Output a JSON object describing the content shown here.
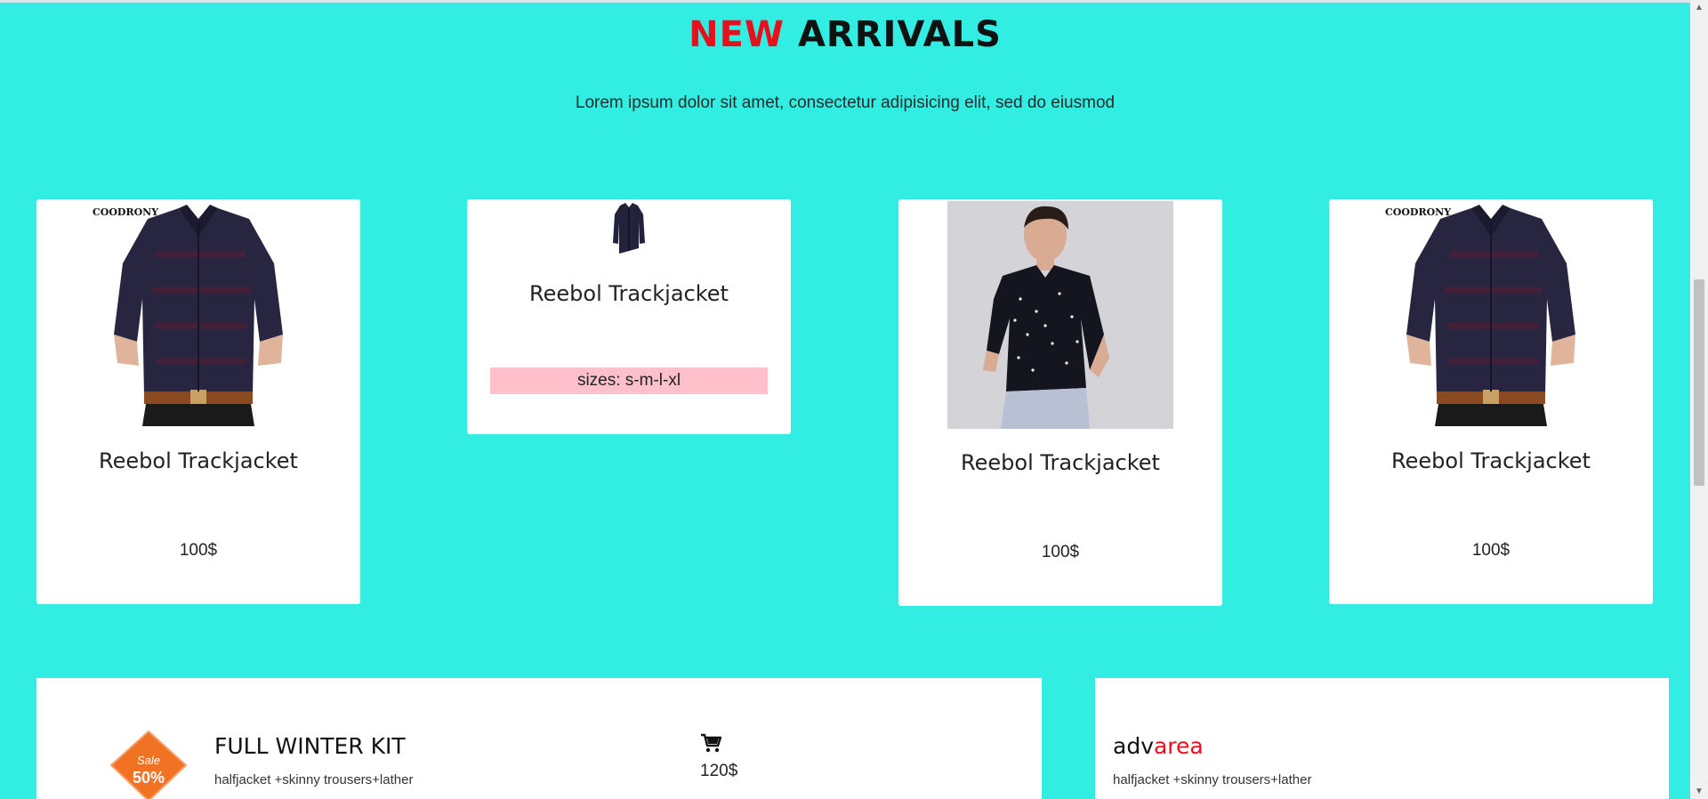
{
  "section": {
    "heading_highlight": "NEW",
    "heading_rest": "ARRIVALS",
    "subtitle": "Lorem ipsum dolor sit amet, consectetur adipisicing elit, sed do eiusmod"
  },
  "products": [
    {
      "title": "Reebol Trackjacket",
      "price": "100$",
      "image": "shirt-photo",
      "brand": "COODRONY"
    },
    {
      "title": "Reebol Trackjacket",
      "sizes": "sizes: s-m-l-xl",
      "image": "jacket-thumbnail"
    },
    {
      "title": "Reebol Trackjacket",
      "price": "100$",
      "image": "model-photo"
    },
    {
      "title": "Reebol Trackjacket",
      "price": "100$",
      "image": "shirt-photo",
      "brand": "COODRONY"
    }
  ],
  "kit": {
    "title": "FULL WINTER KIT",
    "description": "halfjacket +skinny trousers+lather",
    "price": "120$",
    "badge_label": "Sale",
    "badge_value": "50%",
    "cart_icon": "cart-icon"
  },
  "adv": {
    "title_plain": "adv",
    "title_accent": "area",
    "description": "halfjacket +skinny trousers+lather"
  },
  "colors": {
    "background": "#31ede2",
    "accent": "#e8101c",
    "sizes_bg": "#ffc0cb"
  }
}
